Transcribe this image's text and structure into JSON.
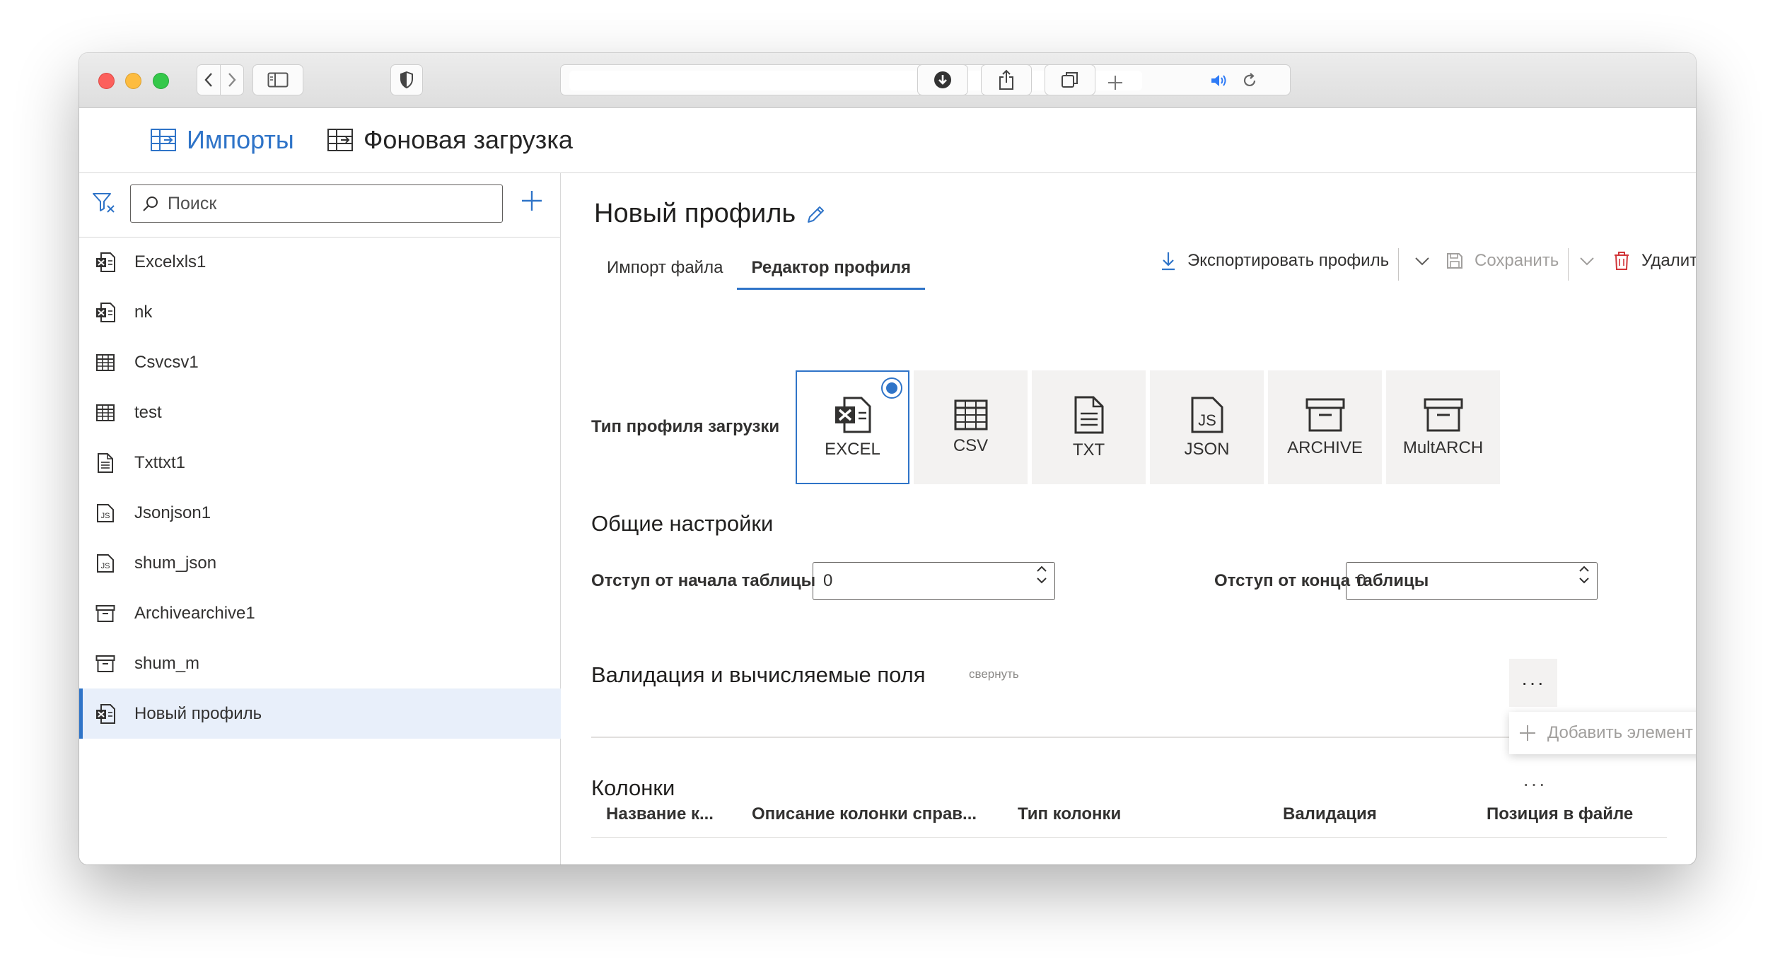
{
  "browser": {
    "address_text": ""
  },
  "app_header": {
    "tabs": [
      {
        "label": "Импорты",
        "active": true
      },
      {
        "label": "Фоновая загрузка",
        "active": false
      }
    ]
  },
  "sidebar": {
    "search_placeholder": "Поиск",
    "items": [
      {
        "label": "Excelxls1",
        "icon": "excel-icon"
      },
      {
        "label": "nk",
        "icon": "excel-icon"
      },
      {
        "label": "Csvcsv1",
        "icon": "csv-icon"
      },
      {
        "label": "test",
        "icon": "csv-icon"
      },
      {
        "label": "Txttxt1",
        "icon": "txt-icon"
      },
      {
        "label": "Jsonjson1",
        "icon": "json-icon"
      },
      {
        "label": "shum_json",
        "icon": "json-icon"
      },
      {
        "label": "Archivearchive1",
        "icon": "archive-icon"
      },
      {
        "label": "shum_m",
        "icon": "archive-icon"
      },
      {
        "label": "Новый профиль",
        "icon": "excel-icon",
        "selected": true
      }
    ]
  },
  "main": {
    "title": "Новый профиль",
    "tabs": [
      {
        "label": "Импорт файла",
        "active": false
      },
      {
        "label": "Редактор профиля",
        "active": true
      }
    ],
    "commands": {
      "export": "Экспортировать профиль",
      "save": "Сохранить",
      "delete": "Удалить"
    },
    "profile_type_label": "Тип профиля загрузки",
    "profile_types": [
      {
        "label": "EXCEL",
        "selected": true
      },
      {
        "label": "CSV",
        "selected": false
      },
      {
        "label": "TXT",
        "selected": false
      },
      {
        "label": "JSON",
        "selected": false
      },
      {
        "label": "ARCHIVE",
        "selected": false
      },
      {
        "label": "MultARCH",
        "selected": false
      }
    ],
    "general": {
      "heading": "Общие настройки",
      "offset_start_label": "Отступ от начала таблицы",
      "offset_start_value": "0",
      "offset_end_label": "Отступ от конца таблицы",
      "offset_end_value": "0"
    },
    "validation": {
      "heading": "Валидация и вычисляемые поля",
      "collapse": "свернуть",
      "more": "···",
      "menu_add": "Добавить элемент"
    },
    "columns": {
      "heading": "Колонки",
      "more": "···",
      "headers": [
        "Название к...",
        "Описание колонки справ...",
        "Тип колонки",
        "Валидация",
        "Позиция в файле"
      ]
    }
  },
  "colors": {
    "accent": "#2f74c8",
    "selected_bg": "#e8effa",
    "delete": "#d13438",
    "tile_bg": "#f3f2f1"
  }
}
